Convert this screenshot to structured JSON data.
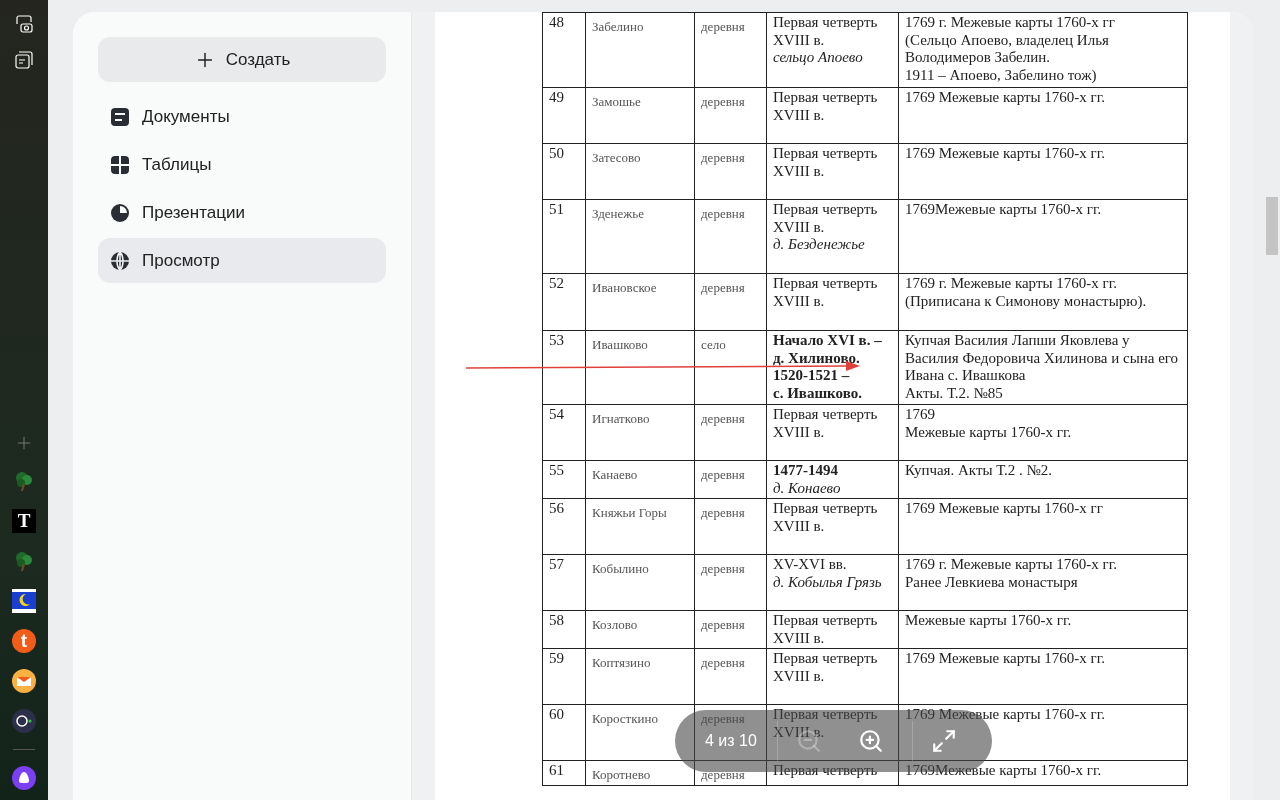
{
  "rail": {
    "bottom_icons": [
      {
        "kind": "plus"
      },
      {
        "kind": "tree"
      },
      {
        "kind": "letter",
        "text": "T"
      },
      {
        "kind": "tree"
      },
      {
        "kind": "flag"
      },
      {
        "kind": "bubble",
        "text": "t"
      },
      {
        "kind": "mail"
      },
      {
        "kind": "camera"
      },
      {
        "kind": "divider"
      },
      {
        "kind": "assistant"
      }
    ]
  },
  "sidebar": {
    "create_button": "Создать",
    "items": [
      {
        "label": "Документы",
        "selected": false
      },
      {
        "label": "Таблицы",
        "selected": false
      },
      {
        "label": "Презентации",
        "selected": false
      },
      {
        "label": "Просмотр",
        "selected": true
      }
    ]
  },
  "table": {
    "rows": [
      {
        "number": "48",
        "name": "Забелино",
        "type": "деревня",
        "date": "Первая четверть\nXVIII в.\n*сельцо Апоево*",
        "source": "1769 г. Межевые карты 1760-х гг\n(Сельцо Апоево, владелец Илья Володимеров Забелин.\n1911 – Апоево, Забелино тож)"
      },
      {
        "number": "49",
        "name": "Замошье",
        "type": "деревня",
        "date": "Первая четверть\nXVIII в.",
        "source": "1769 Межевые карты 1760-х гг."
      },
      {
        "number": "50",
        "name": "Затесово",
        "type": "деревня",
        "date": "Первая четверть\nXVIII в.",
        "source": "1769 Межевые карты 1760-х гг."
      },
      {
        "number": "51",
        "name": "Зденежье",
        "type": "деревня",
        "date": "Первая четверть\nXVIII в.\n*д. Безденежье*",
        "source": " 1769Межевые карты 1760-х гг."
      },
      {
        "number": "52",
        "name": "Ивановское",
        "type": "деревня",
        "date": "Первая четверть\nXVIII в.",
        "source": " 1769 г. Межевые карты 1760-х гг.\n(Приписана к Симонову монастырю)."
      },
      {
        "number": "53",
        "name": "Ивашково",
        "type": "село",
        "date": "**Начало XVI в. –\nд. Хилиново.\n1520-1521 –\nс. Ивашково.**",
        "source": "Купчая Василия Лапши Яковлева у Василия Федоровича Хилинова и сына его Ивана с. Ивашкова\nАкты. Т.2. №85"
      },
      {
        "number": "54",
        "name": "Игнатково",
        "type": "деревня",
        "date": "Первая четверть\nXVIII в.",
        "source": " 1769\nМежевые карты 1760-х гг."
      },
      {
        "number": "55",
        "name": "Канаево",
        "type": "деревня",
        "date": "**1477-1494**\n*д. Конаево*",
        "source": "Купчая. Акты Т.2 . №2."
      },
      {
        "number": "56",
        "name": "Княжьи Горы",
        "type": "деревня",
        "date": "Первая четверть\nXVIII в.",
        "source": "1769 Межевые карты 1760-х гг"
      },
      {
        "number": "57",
        "name": "Кобылино",
        "type": "деревня",
        "date": "XV-XVI  вв.\n*д. Кобылья Грязь*",
        "source": "1769 г. Межевые карты 1760-х гг.\nРанее Левкиева монастыря"
      },
      {
        "number": "58",
        "name": "Козлово",
        "type": "деревня",
        "date": "Первая четверть\nXVIII в.",
        "source": "Межевые карты 1760-х гг."
      },
      {
        "number": "59",
        "name": "Коптязино",
        "type": "деревня",
        "date": "Первая четверть\nXVIII в.",
        "source": "1769 Межевые карты 1760-х гг."
      },
      {
        "number": "60",
        "name": "Коросткино",
        "type": "деревня",
        "date": "Первая четверть\nXVIII в.",
        "source": "1769 Межевые карты 1760-х гг."
      },
      {
        "number": "61",
        "name": "Коротнево",
        "type": "деревня",
        "date": "Первая четверть",
        "source": "1769Межевые карты 1760-х гг."
      }
    ]
  },
  "viewer_toolbar": {
    "page_indicator": "4 из 10",
    "zoom_out_disabled": true,
    "zoom_in_disabled": false
  }
}
